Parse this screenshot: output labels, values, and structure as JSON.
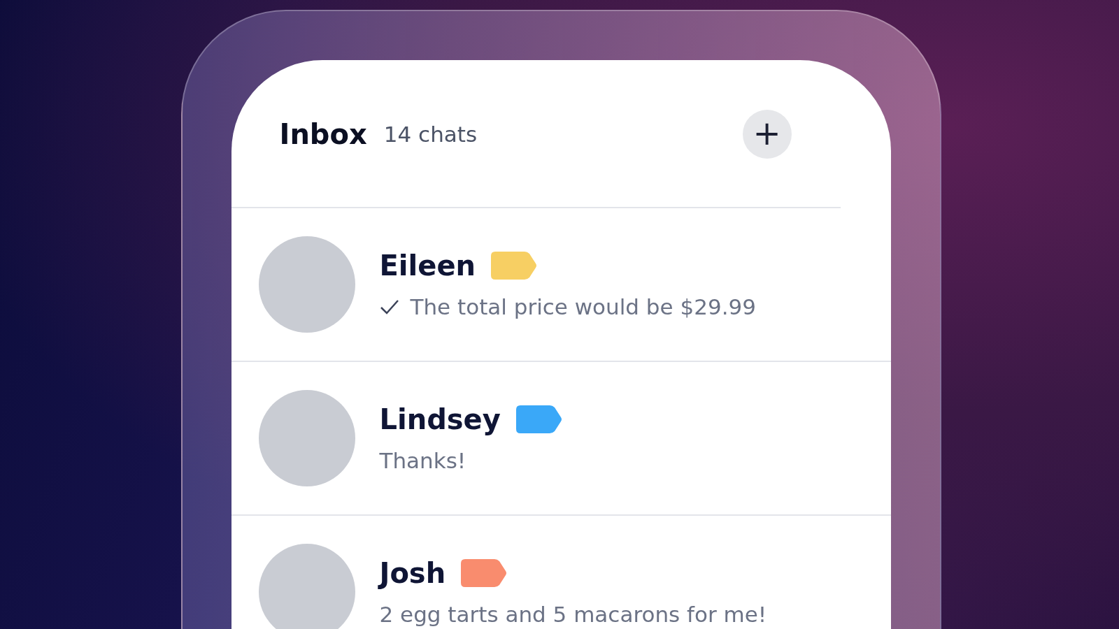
{
  "header": {
    "title": "Inbox",
    "count": "14 chats",
    "add_button": "+"
  },
  "chats": [
    {
      "name": "Eileen",
      "color": "#f7cf63",
      "read": true,
      "message": "The total price would be $29.99"
    },
    {
      "name": "Lindsey",
      "color": "#3aa8f8",
      "read": false,
      "message": "Thanks!"
    },
    {
      "name": "Josh",
      "color": "#f98c6e",
      "read": false,
      "message": "2 egg tarts and 5 macarons for me!"
    }
  ]
}
